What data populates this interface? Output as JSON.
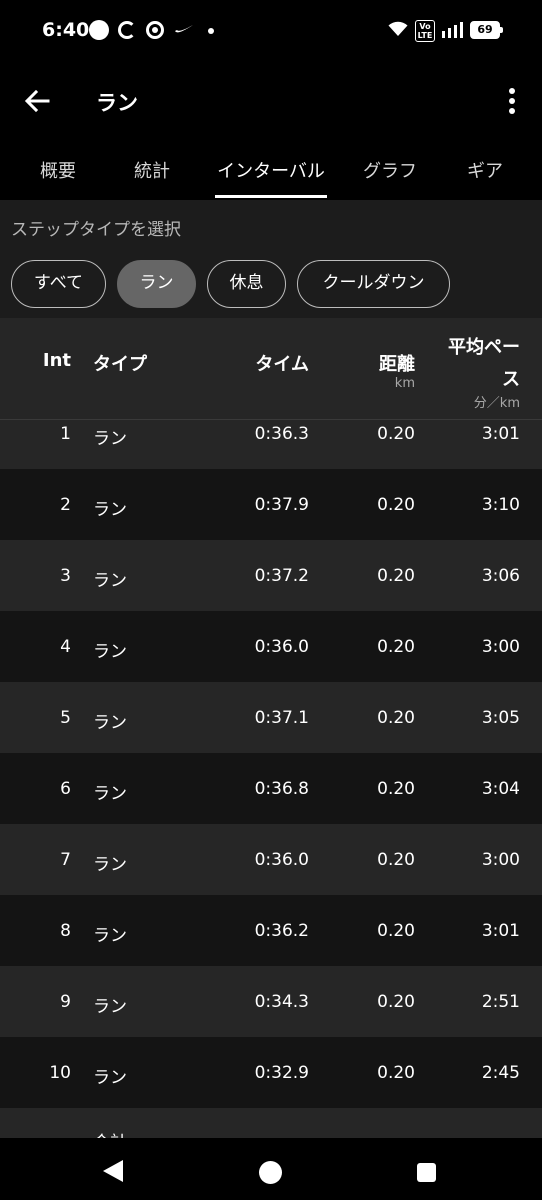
{
  "status_bar": {
    "time": "6:40",
    "network_badge": "Vo\nLTE",
    "battery": "69",
    "icons": [
      "notification-dot-icon",
      "sync-icon",
      "camera-icon",
      "nike-swoosh-icon",
      "more-notifications-dot-icon",
      "wifi-icon",
      "volte-icon",
      "signal-icon",
      "battery-icon"
    ]
  },
  "header": {
    "title": "ラン",
    "back_icon": "arrow-left-icon",
    "menu_icon": "more-vertical-icon"
  },
  "tabs": [
    {
      "label": "概要",
      "active": false
    },
    {
      "label": "統計",
      "active": false
    },
    {
      "label": "インターバル",
      "active": true
    },
    {
      "label": "グラフ",
      "active": false
    },
    {
      "label": "ギア",
      "active": false
    }
  ],
  "filter": {
    "label": "ステップタイプを選択",
    "chips": [
      {
        "label": "すべて",
        "selected": false
      },
      {
        "label": "ラン",
        "selected": true
      },
      {
        "label": "休息",
        "selected": false
      },
      {
        "label": "クールダウン",
        "selected": false
      }
    ]
  },
  "table": {
    "headers": {
      "int": "Int",
      "type": "タイプ",
      "time": "タイム",
      "distance": "距離",
      "distance_unit": "km",
      "pace_line1": "平均ペー",
      "pace_line2": "ス",
      "pace_unit": "分／km"
    },
    "rows": [
      {
        "int": "1",
        "type": "ラン",
        "time": "0:36.3",
        "distance": "0.20",
        "pace": "3:01"
      },
      {
        "int": "2",
        "type": "ラン",
        "time": "0:37.9",
        "distance": "0.20",
        "pace": "3:10"
      },
      {
        "int": "3",
        "type": "ラン",
        "time": "0:37.2",
        "distance": "0.20",
        "pace": "3:06"
      },
      {
        "int": "4",
        "type": "ラン",
        "time": "0:36.0",
        "distance": "0.20",
        "pace": "3:00"
      },
      {
        "int": "5",
        "type": "ラン",
        "time": "0:37.1",
        "distance": "0.20",
        "pace": "3:05"
      },
      {
        "int": "6",
        "type": "ラン",
        "time": "0:36.8",
        "distance": "0.20",
        "pace": "3:04"
      },
      {
        "int": "7",
        "type": "ラン",
        "time": "0:36.0",
        "distance": "0.20",
        "pace": "3:00"
      },
      {
        "int": "8",
        "type": "ラン",
        "time": "0:36.2",
        "distance": "0.20",
        "pace": "3:01"
      },
      {
        "int": "9",
        "type": "ラン",
        "time": "0:34.3",
        "distance": "0.20",
        "pace": "2:51"
      },
      {
        "int": "10",
        "type": "ラン",
        "time": "0:32.9",
        "distance": "0.20",
        "pace": "2:45"
      },
      {
        "int": "",
        "type": "合計",
        "time": "",
        "distance": "",
        "pace": ""
      }
    ]
  },
  "navbar": {
    "icons": [
      "nav-back-icon",
      "nav-home-icon",
      "nav-recents-icon"
    ]
  }
}
